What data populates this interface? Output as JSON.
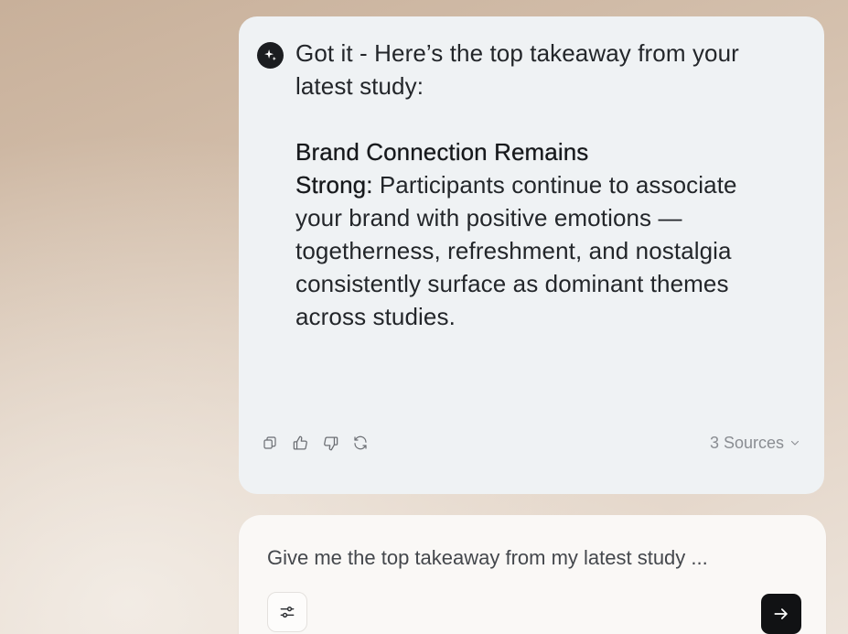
{
  "response": {
    "icon": "ai-sparkle-icon",
    "intro_line1": "Got it - Here’s the top takeaway from your",
    "intro_line2": "latest study:",
    "heading_line1": "Brand Connection Remains",
    "heading_line2": "Strong:",
    "body_line1": " Participants continue to associate",
    "body_line2": "your brand with positive emotions —",
    "body_line3": "togetherness, refreshment, and nostalgia",
    "body_line4": "consistently surface as dominant themes",
    "body_line5": "across studies.",
    "actions": [
      "copy-icon",
      "thumbs-up-icon",
      "thumbs-down-icon",
      "regenerate-icon"
    ],
    "sources_label": "3 Sources",
    "sources_icon": "chevron-down-icon"
  },
  "composer": {
    "prompt_text": "Give me the top takeaway from my latest study ...",
    "tools_icon": "sliders-icon",
    "send_icon": "arrow-right-icon"
  },
  "colors": {
    "card_bg": "#eff2f4",
    "composer_bg": "#faf8f6",
    "send_button": "#111214",
    "text_primary": "#23262a",
    "text_muted": "#8a8d92"
  }
}
